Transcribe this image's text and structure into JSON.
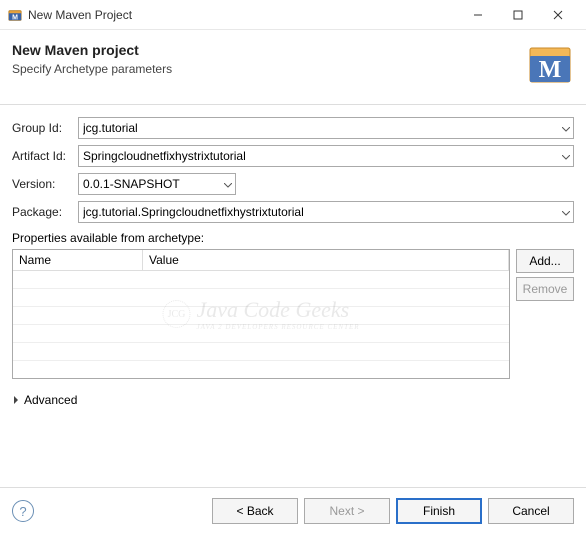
{
  "titlebar": {
    "title": "New Maven Project"
  },
  "header": {
    "title": "New Maven project",
    "subtitle": "Specify Archetype parameters"
  },
  "form": {
    "groupId": {
      "label": "Group Id:",
      "value": "jcg.tutorial"
    },
    "artifactId": {
      "label": "Artifact Id:",
      "value": "Springcloudnetfixhystrixtutorial"
    },
    "version": {
      "label": "Version:",
      "value": "0.0.1-SNAPSHOT"
    },
    "packageName": {
      "label": "Package:",
      "value": "jcg.tutorial.Springcloudnetfixhystrixtutorial"
    }
  },
  "propertiesSection": {
    "label": "Properties available from archetype:",
    "columns": {
      "name": "Name",
      "value": "Value"
    }
  },
  "sideButtons": {
    "add": "Add...",
    "remove": "Remove"
  },
  "advanced": {
    "label": "Advanced"
  },
  "footer": {
    "back": "< Back",
    "next": "Next >",
    "finish": "Finish",
    "cancel": "Cancel"
  },
  "watermark": {
    "main": "Java Code Geeks",
    "sub": "JAVA 2 DEVELOPERS RESOURCE CENTER",
    "badge": "JCG"
  }
}
